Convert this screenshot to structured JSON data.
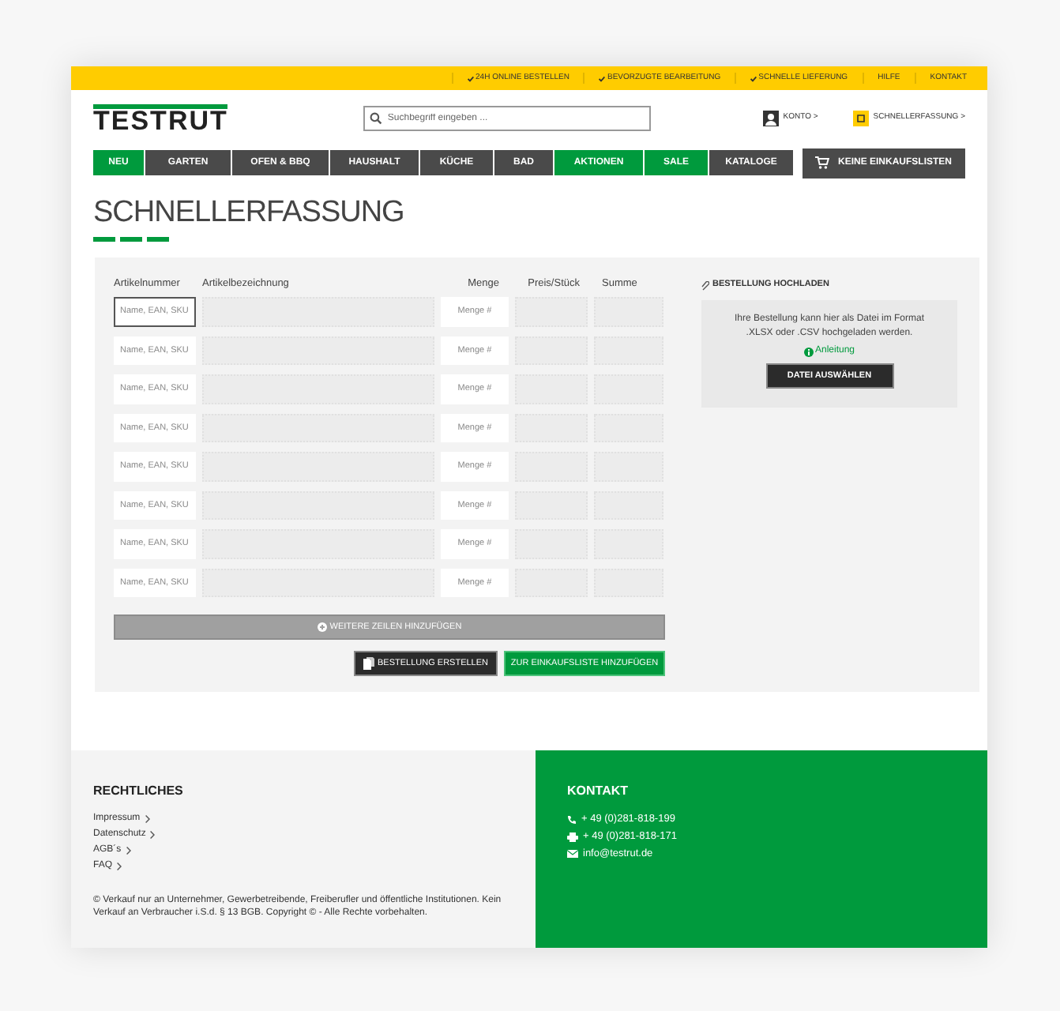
{
  "top_bar": {
    "links": [
      {
        "label": "24H ONLINE BESTELLEN",
        "checkmark": true
      },
      {
        "label": "BEVORZUGTE BEARBEITUNG",
        "checkmark": true
      },
      {
        "label": "SCHNELLE LIEFERUNG",
        "checkmark": true
      },
      {
        "label": "HILFE",
        "checkmark": false
      },
      {
        "label": "KONTAKT",
        "checkmark": false
      }
    ]
  },
  "header": {
    "logo": "TESTRUT",
    "search": {
      "placeholder": "Suchbegriff eingeben ..."
    },
    "account": "KONTO >",
    "quick_order": "SCHNELLERFASSUNG >"
  },
  "nav": {
    "items": [
      {
        "label": "NEU",
        "highlighted": true
      },
      {
        "label": "GARTEN",
        "highlighted": false
      },
      {
        "label": "OFEN & BBQ",
        "highlighted": false
      },
      {
        "label": "HAUSHALT",
        "highlighted": false
      },
      {
        "label": "KÜCHE",
        "highlighted": false
      },
      {
        "label": "BAD",
        "highlighted": false
      },
      {
        "label": "AKTIONEN",
        "highlighted": true
      },
      {
        "label": "SALE",
        "highlighted": true
      },
      {
        "label": "KATALOGE",
        "highlighted": false
      }
    ],
    "shopping_lists": "KEINE EINKAUFSLISTEN"
  },
  "page_title": "SCHNELLERFASSUNG",
  "form": {
    "columns": [
      "Artikelnummer",
      "Artikelbezeichnung",
      "Menge",
      "Preis/Stück",
      "Summe"
    ],
    "rows": [
      {
        "article_placeholder": "Name, EAN, SKU",
        "quantity_placeholder": "Menge #",
        "focused": true
      },
      {
        "article_placeholder": "Name, EAN, SKU",
        "quantity_placeholder": "Menge #",
        "focused": false
      },
      {
        "article_placeholder": "Name, EAN, SKU",
        "quantity_placeholder": "Menge #",
        "focused": false
      },
      {
        "article_placeholder": "Name, EAN, SKU",
        "quantity_placeholder": "Menge #",
        "focused": false
      },
      {
        "article_placeholder": "Name, EAN, SKU",
        "quantity_placeholder": "Menge #",
        "focused": false
      },
      {
        "article_placeholder": "Name, EAN, SKU",
        "quantity_placeholder": "Menge #",
        "focused": false
      },
      {
        "article_placeholder": "Name, EAN, SKU",
        "quantity_placeholder": "Menge #",
        "focused": false
      },
      {
        "article_placeholder": "Name, EAN, SKU",
        "quantity_placeholder": "Menge #",
        "focused": false
      }
    ],
    "add_rows": "WEITERE ZEILEN HINZUFÜGEN",
    "create_order": "BESTELLUNG ERSTELLEN",
    "add_to_list": "ZUR EINKAUFSLISTE HINZUFÜGEN"
  },
  "upload": {
    "title": "BESTELLUNG HOCHLADEN",
    "text": "Ihre Bestellung kann hier als Datei im Format .XLSX oder .CSV hochgeladen werden.",
    "help_link": "Anleitung",
    "button": "DATEI AUSWÄHLEN"
  },
  "footer": {
    "legal": {
      "title": "RECHTLICHES",
      "links": [
        "Impressum",
        "Datenschutz",
        "AGB´s",
        "FAQ"
      ],
      "notice": "© Verkauf nur an Unternehmer, Gewerbetreibende, Freiberufler und öffentliche Institutionen. Kein Verkauf an Verbraucher i.S.d. § 13 BGB. Copyright © - Alle Rechte vorbehalten."
    },
    "contact": {
      "title": "KONTAKT",
      "items": [
        {
          "kind": "phone",
          "text": "+ 49 (0)281-818-199"
        },
        {
          "kind": "fax",
          "text": "+ 49 (0)281-818-171"
        },
        {
          "kind": "mail",
          "text": "info@testrut.de"
        }
      ]
    }
  }
}
